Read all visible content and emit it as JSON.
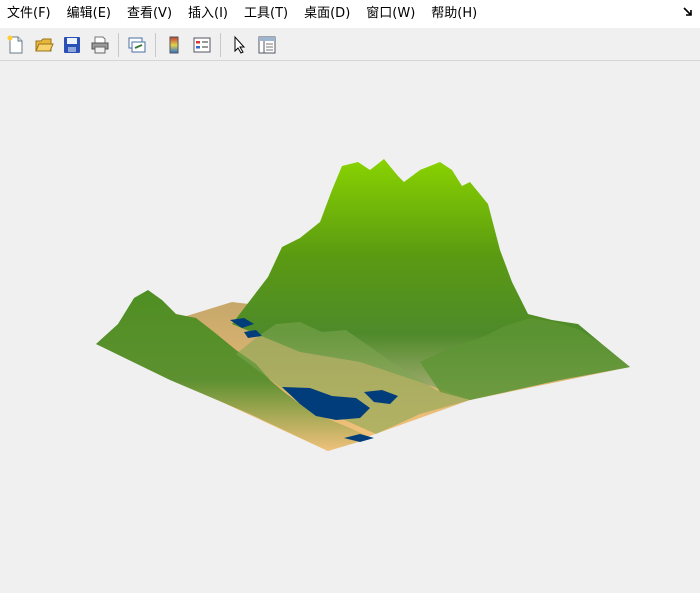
{
  "menubar": {
    "items": [
      {
        "label": "文件(F)"
      },
      {
        "label": "编辑(E)"
      },
      {
        "label": "查看(V)"
      },
      {
        "label": "插入(I)"
      },
      {
        "label": "工具(T)"
      },
      {
        "label": "桌面(D)"
      },
      {
        "label": "窗口(W)"
      },
      {
        "label": "帮助(H)"
      }
    ]
  },
  "toolbar": {
    "buttons": [
      {
        "icon": "new-figure-icon"
      },
      {
        "icon": "open-file-icon"
      },
      {
        "icon": "save-icon"
      },
      {
        "icon": "print-icon"
      },
      {
        "icon": "link-plot-icon"
      },
      {
        "icon": "insert-colorbar-icon"
      },
      {
        "icon": "insert-legend-icon"
      },
      {
        "icon": "edit-plot-pointer-icon"
      },
      {
        "icon": "property-inspector-icon"
      }
    ]
  },
  "figure": {
    "type": "3d-surface-terrain",
    "colors": {
      "peak": "#86d000",
      "mid": "#4f8f22",
      "lowland": "#f5c07a",
      "water": "#003d7a"
    }
  }
}
